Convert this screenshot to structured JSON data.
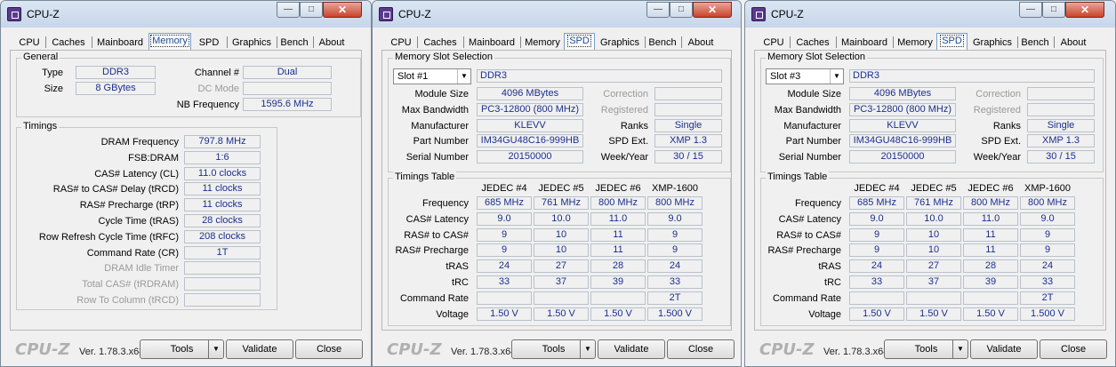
{
  "app_title": "CPU-Z",
  "titlebar_buttons": {
    "min": "—",
    "max": "□",
    "close": "✕"
  },
  "tabs": [
    "CPU",
    "Caches",
    "Mainboard",
    "Memory",
    "SPD",
    "Graphics",
    "Bench",
    "About"
  ],
  "footer": {
    "logo": "CPU-Z",
    "version": "Ver. 1.78.3.x64",
    "tools": "Tools",
    "validate": "Validate",
    "close": "Close"
  },
  "memory": {
    "general_title": "General",
    "type_label": "Type",
    "type_value": "DDR3",
    "size_label": "Size",
    "size_value": "8 GBytes",
    "channel_label": "Channel #",
    "channel_value": "Dual",
    "dcmode_label": "DC Mode",
    "dcmode_value": "",
    "nbfreq_label": "NB Frequency",
    "nbfreq_value": "1595.6 MHz",
    "timings_title": "Timings",
    "timings": [
      {
        "label": "DRAM Frequency",
        "value": "797.8 MHz",
        "disabled": false
      },
      {
        "label": "FSB:DRAM",
        "value": "1:6",
        "disabled": false
      },
      {
        "label": "CAS# Latency (CL)",
        "value": "11.0 clocks",
        "disabled": false
      },
      {
        "label": "RAS# to CAS# Delay (tRCD)",
        "value": "11 clocks",
        "disabled": false
      },
      {
        "label": "RAS# Precharge (tRP)",
        "value": "11 clocks",
        "disabled": false
      },
      {
        "label": "Cycle Time (tRAS)",
        "value": "28 clocks",
        "disabled": false
      },
      {
        "label": "Row Refresh Cycle Time (tRFC)",
        "value": "208 clocks",
        "disabled": false
      },
      {
        "label": "Command Rate (CR)",
        "value": "1T",
        "disabled": false
      },
      {
        "label": "DRAM Idle Timer",
        "value": "",
        "disabled": true
      },
      {
        "label": "Total CAS# (tRDRAM)",
        "value": "",
        "disabled": true
      },
      {
        "label": "Row To Column (tRCD)",
        "value": "",
        "disabled": true
      }
    ]
  },
  "spd_common": {
    "slot_group_title": "Memory Slot Selection",
    "type_value": "DDR3",
    "labels": {
      "module_size": "Module Size",
      "max_bandwidth": "Max Bandwidth",
      "manufacturer": "Manufacturer",
      "part_number": "Part Number",
      "serial_number": "Serial Number",
      "correction": "Correction",
      "registered": "Registered",
      "ranks": "Ranks",
      "spd_ext": "SPD Ext.",
      "week_year": "Week/Year"
    },
    "values": {
      "module_size": "4096 MBytes",
      "max_bandwidth": "PC3-12800 (800 MHz)",
      "manufacturer": "KLEVV",
      "part_number": "IM34GU48C16-999HB",
      "serial_number": "20150000",
      "ranks": "Single",
      "spd_ext": "XMP 1.3",
      "week_year": "30 / 15"
    },
    "timings_title": "Timings Table",
    "columns": [
      "JEDEC #4",
      "JEDEC #5",
      "JEDEC #6",
      "XMP-1600"
    ],
    "rows": [
      {
        "label": "Frequency",
        "cells": [
          "685 MHz",
          "761 MHz",
          "800 MHz",
          "800 MHz"
        ]
      },
      {
        "label": "CAS# Latency",
        "cells": [
          "9.0",
          "10.0",
          "11.0",
          "9.0"
        ]
      },
      {
        "label": "RAS# to CAS#",
        "cells": [
          "9",
          "10",
          "11",
          "9"
        ]
      },
      {
        "label": "RAS# Precharge",
        "cells": [
          "9",
          "10",
          "11",
          "9"
        ]
      },
      {
        "label": "tRAS",
        "cells": [
          "24",
          "27",
          "28",
          "24"
        ]
      },
      {
        "label": "tRC",
        "cells": [
          "33",
          "37",
          "39",
          "33"
        ]
      },
      {
        "label": "Command Rate",
        "cells": [
          "",
          "",
          "",
          "2T"
        ]
      },
      {
        "label": "Voltage",
        "cells": [
          "1.50 V",
          "1.50 V",
          "1.50 V",
          "1.500 V"
        ]
      }
    ]
  },
  "spd_windows": [
    {
      "slot": "Slot #1"
    },
    {
      "slot": "Slot #3"
    }
  ]
}
